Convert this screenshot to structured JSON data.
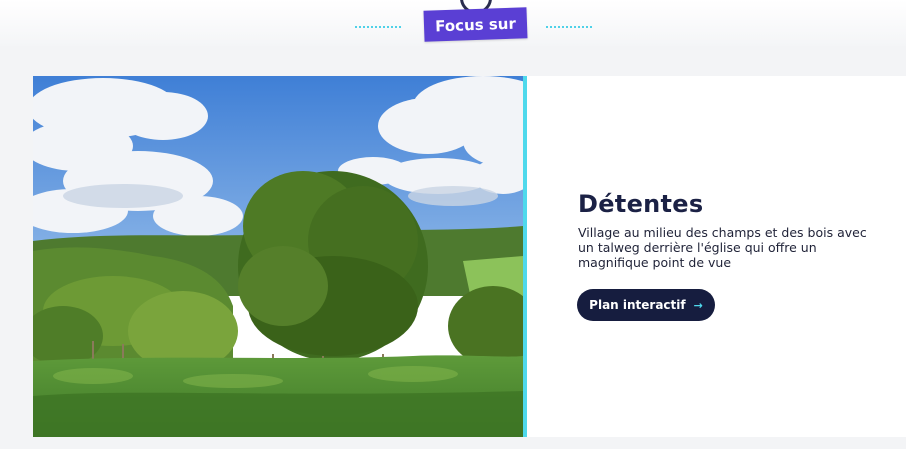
{
  "header": {
    "badge_label": "Focus sur",
    "icon": "focus-circle-icon",
    "accent_color": "#5a3fd4",
    "dots_color": "#4fd1e8"
  },
  "feature": {
    "image": "landscape-photo",
    "title": "Détentes",
    "description": "Village au milieu des champs et des bois avec un talweg derrière l'église qui offre un magnifique point de vue",
    "cta_label": "Plan interactif",
    "cta_icon": "arrow-right-icon",
    "cta_arrow_glyph": "→",
    "border_color": "#4fd9ec",
    "button_color": "#161d3f"
  }
}
